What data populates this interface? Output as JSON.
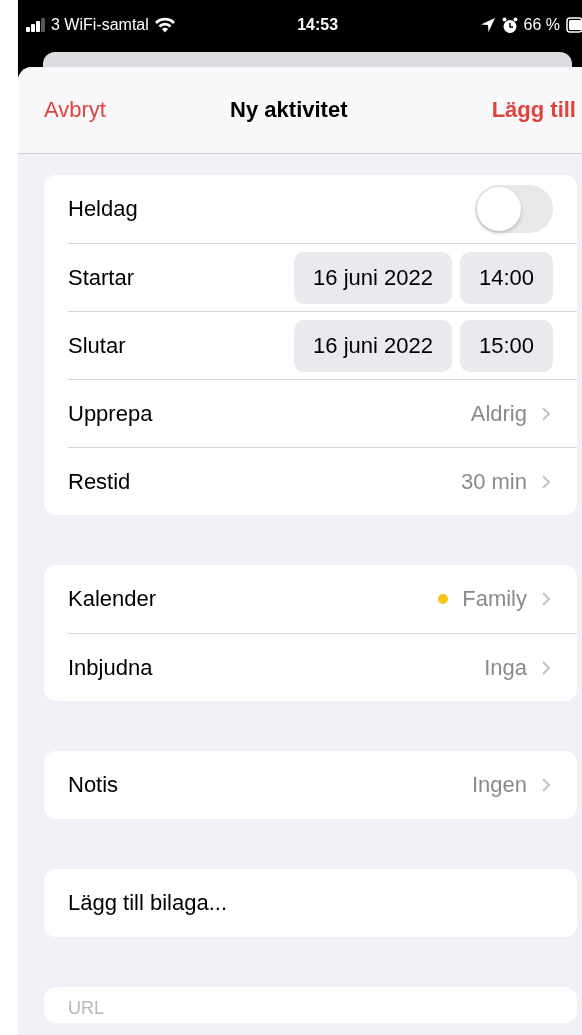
{
  "status_bar": {
    "carrier": "3 WiFi-samtal",
    "time": "14:53",
    "battery": "66 %"
  },
  "nav": {
    "cancel": "Avbryt",
    "title": "Ny aktivitet",
    "add": "Lägg till"
  },
  "groups": [
    {
      "rows": [
        {
          "kind": "toggle",
          "label": "Heldag",
          "on": false
        },
        {
          "kind": "datetime",
          "label": "Startar",
          "date": "16 juni 2022",
          "time": "14:00"
        },
        {
          "kind": "datetime",
          "label": "Slutar",
          "date": "16 juni 2022",
          "time": "15:00"
        },
        {
          "kind": "value",
          "label": "Upprepa",
          "value": "Aldrig"
        },
        {
          "kind": "value",
          "label": "Restid",
          "value": "30 min"
        }
      ]
    },
    {
      "rows": [
        {
          "kind": "value",
          "label": "Kalender",
          "value": "Family",
          "color": "#f5c518"
        },
        {
          "kind": "value",
          "label": "Inbjudna",
          "value": "Inga"
        }
      ]
    },
    {
      "rows": [
        {
          "kind": "value",
          "label": "Notis",
          "value": "Ingen"
        }
      ]
    },
    {
      "rows": [
        {
          "kind": "action",
          "label": "Lägg till bilaga..."
        }
      ]
    },
    {
      "rows": [
        {
          "kind": "field",
          "placeholder": "URL"
        }
      ]
    }
  ]
}
